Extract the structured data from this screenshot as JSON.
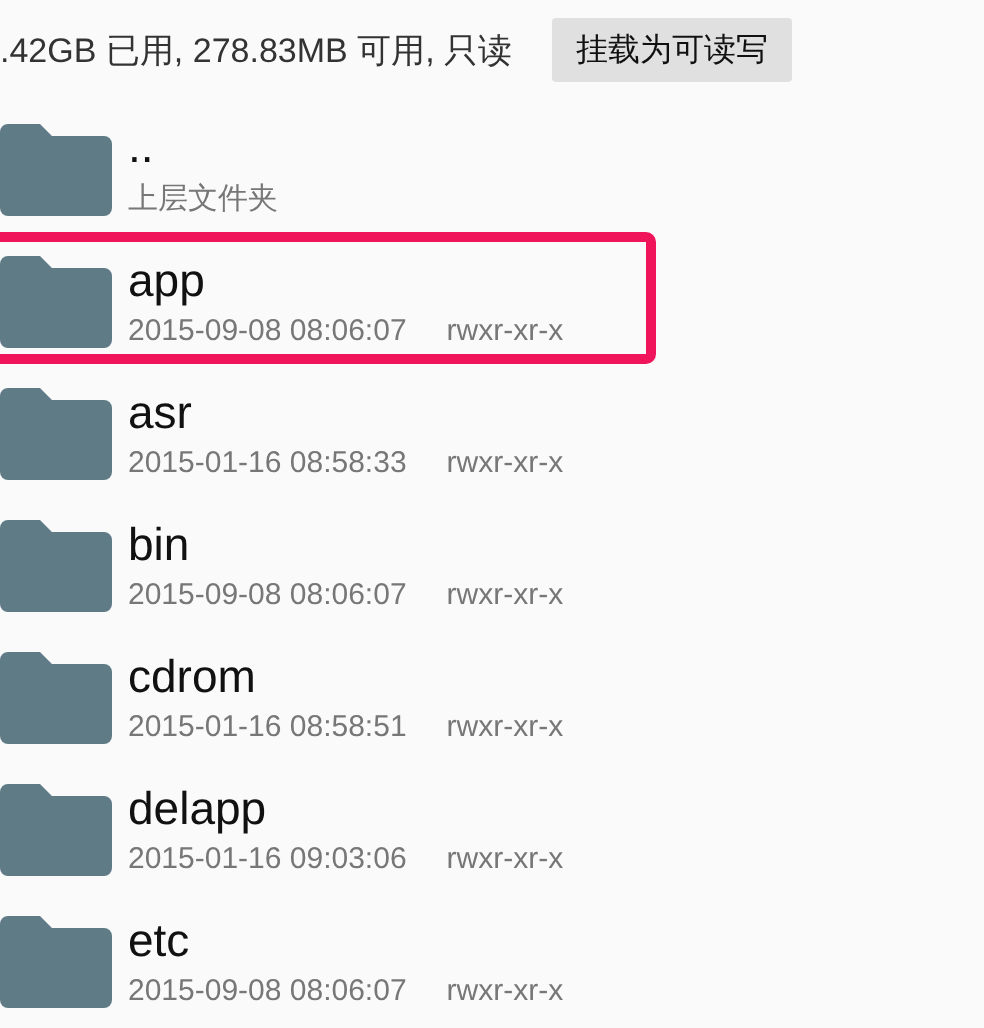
{
  "storage_info": ".42GB 已用, 278.83MB 可用, 只读",
  "mount_button": "挂载为可读写",
  "files": [
    {
      "name": "..",
      "detail": "上层文件夹",
      "highlighted": false
    },
    {
      "name": "app",
      "date": "2015-09-08 08:06:07",
      "permissions": "rwxr-xr-x",
      "highlighted": true
    },
    {
      "name": "asr",
      "date": "2015-01-16 08:58:33",
      "permissions": "rwxr-xr-x",
      "highlighted": false
    },
    {
      "name": "bin",
      "date": "2015-09-08 08:06:07",
      "permissions": "rwxr-xr-x",
      "highlighted": false
    },
    {
      "name": "cdrom",
      "date": "2015-01-16 08:58:51",
      "permissions": "rwxr-xr-x",
      "highlighted": false
    },
    {
      "name": "delapp",
      "date": "2015-01-16 09:03:06",
      "permissions": "rwxr-xr-x",
      "highlighted": false
    },
    {
      "name": "etc",
      "date": "2015-09-08 08:06:07",
      "permissions": "rwxr-xr-x",
      "highlighted": false
    }
  ]
}
